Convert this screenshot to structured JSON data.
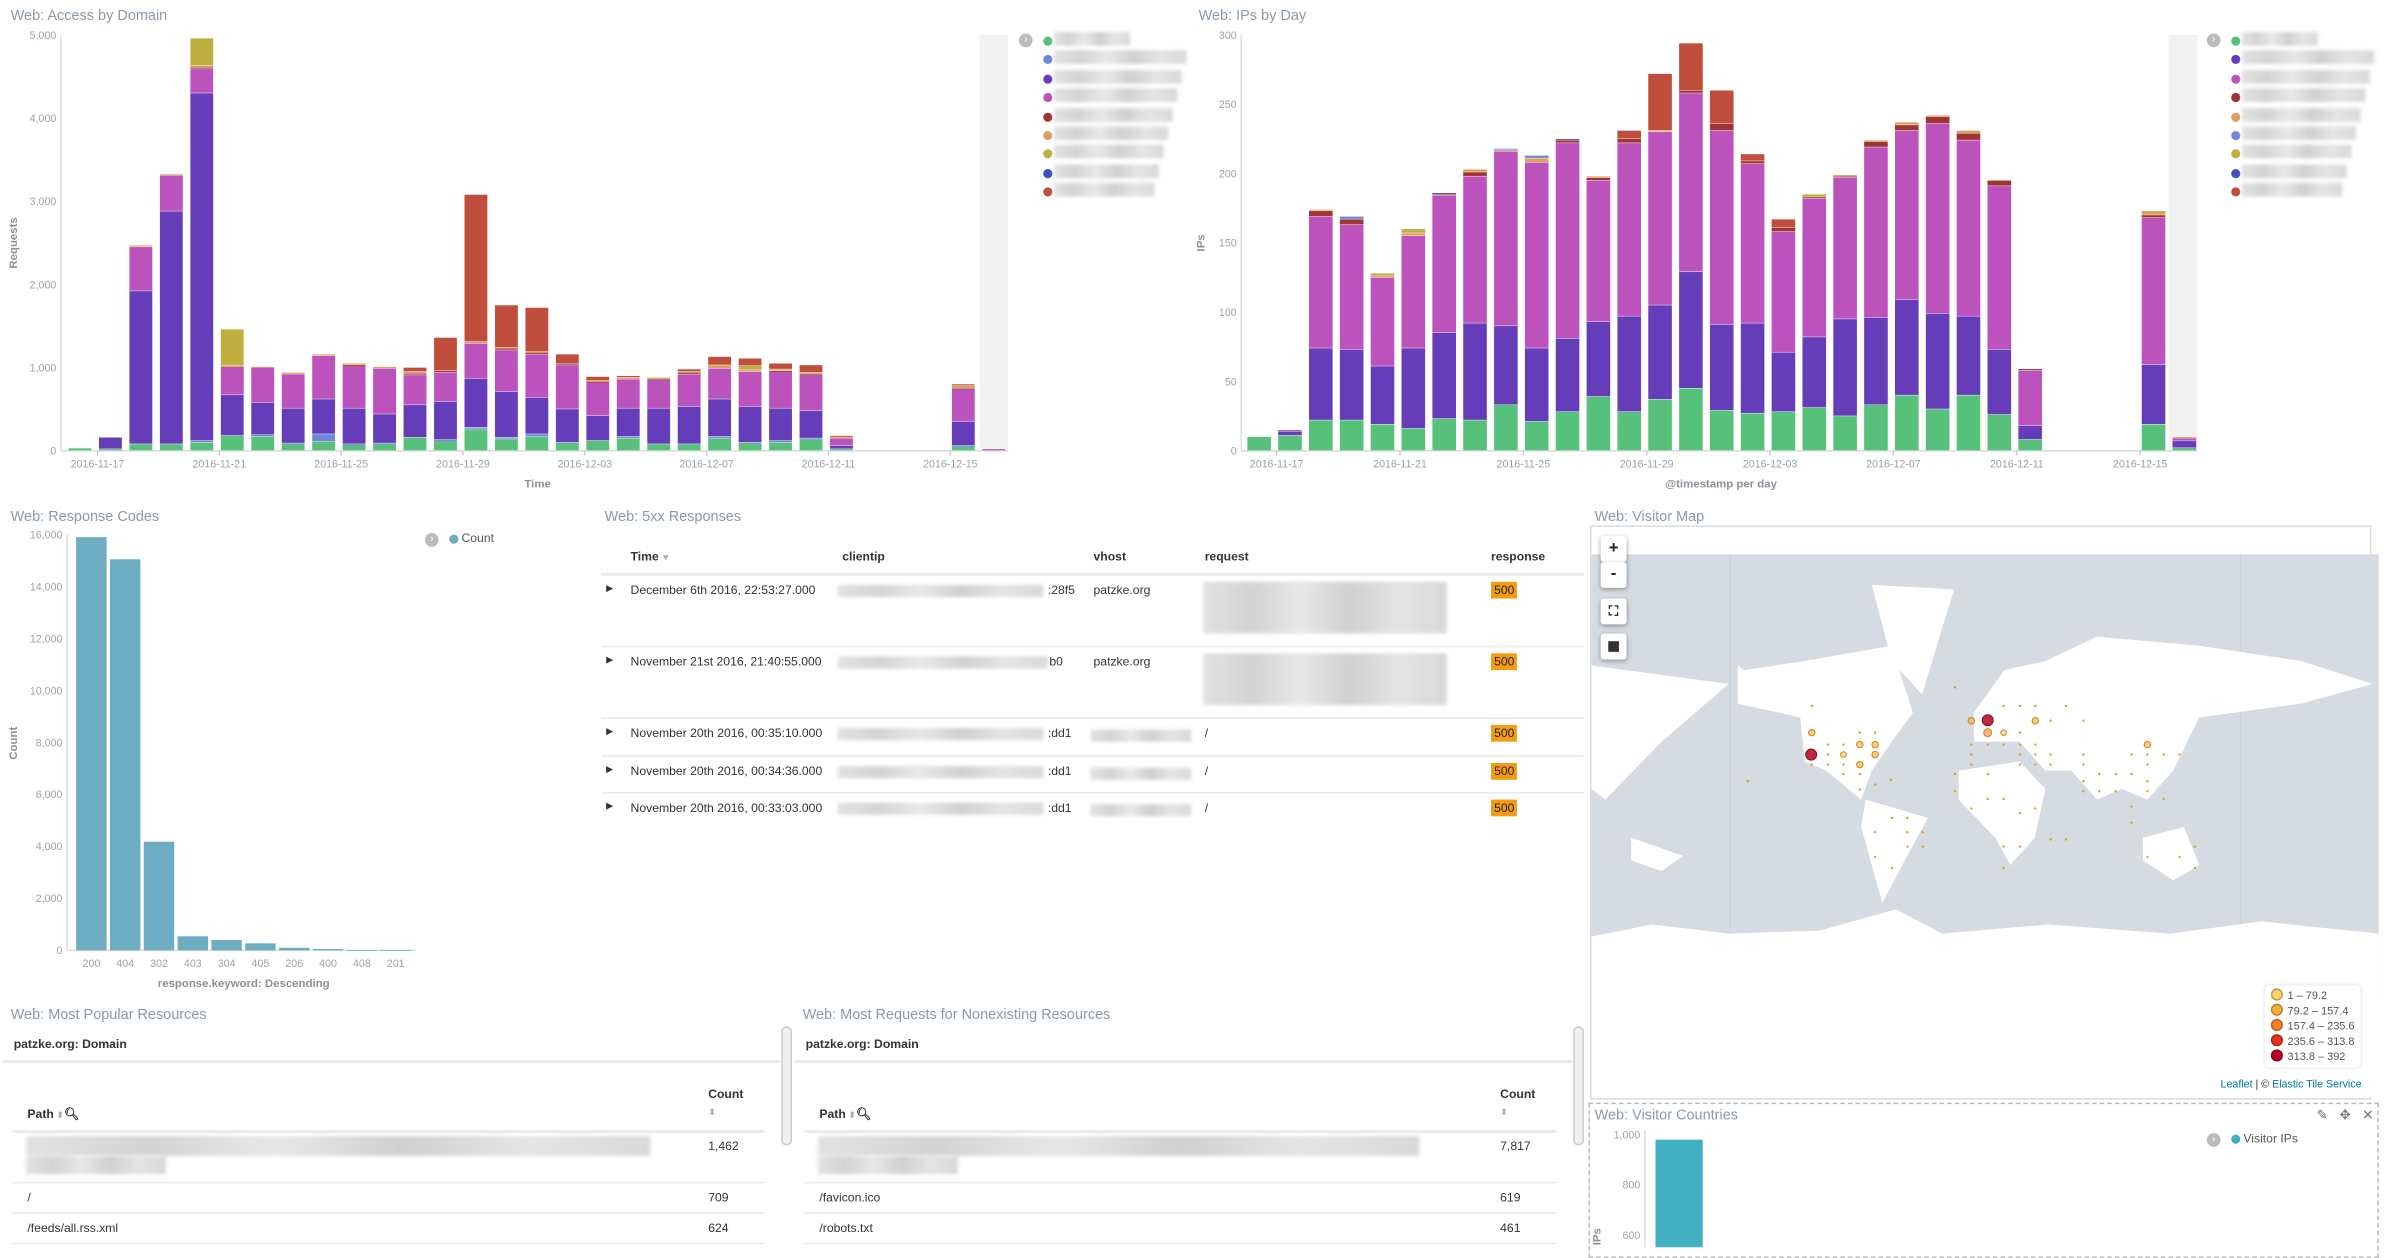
{
  "colors": {
    "green": "#57c17b",
    "lightblue": "#6f87d8",
    "purple": "#663db8",
    "magenta": "#bc52bc",
    "darkred": "#9e3533",
    "orange": "#daa05d",
    "olive": "#bfaf40",
    "blue": "#4050bf",
    "red": "#c04e3c",
    "teal": "#6eadc1",
    "cyan": "#41b0c3",
    "badge": "#f39c12"
  },
  "panels": {
    "access": {
      "title": "Web: Access by Domain"
    },
    "ips": {
      "title": "Web: IPs by Day"
    },
    "codes": {
      "title": "Web: Response Codes",
      "legend": "Count"
    },
    "errors": {
      "title": "Web: 5xx Responses"
    },
    "map": {
      "title": "Web: Visitor Map"
    },
    "popular": {
      "title": "Web: Most Popular Resources"
    },
    "missing": {
      "title": "Web: Most Requests for Nonexisting Resources"
    },
    "countries": {
      "title": "Web: Visitor Countries",
      "legend": "Visitor IPs"
    }
  },
  "chart_data": [
    {
      "type": "bar",
      "stacked": true,
      "title": "Web: Access by Domain",
      "xlabel": "Time",
      "ylabel": "Requests",
      "ylim": [
        0,
        5000
      ],
      "yticks": [
        "0",
        "1,000",
        "2,000",
        "3,000",
        "4,000",
        "5,000"
      ],
      "xticks": [
        "2016-11-17",
        "2016-11-21",
        "2016-11-25",
        "2016-11-29",
        "2016-12-03",
        "2016-12-07",
        "2016-12-11",
        "2016-12-15"
      ],
      "categories": [
        "2016-11-16",
        "2016-11-17",
        "2016-11-18",
        "2016-11-19",
        "2016-11-20",
        "2016-11-21",
        "2016-11-22",
        "2016-11-23",
        "2016-11-24",
        "2016-11-25",
        "2016-11-26",
        "2016-11-27",
        "2016-11-28",
        "2016-11-29",
        "2016-11-30",
        "2016-12-01",
        "2016-12-02",
        "2016-12-03",
        "2016-12-04",
        "2016-12-05",
        "2016-12-06",
        "2016-12-07",
        "2016-12-08",
        "2016-12-09",
        "2016-12-10",
        "2016-12-11",
        "2016-12-12",
        "2016-12-13",
        "2016-12-14",
        "2016-12-15",
        "2016-12-16"
      ],
      "legend_colors": [
        "#57c17b",
        "#6f87d8",
        "#663db8",
        "#bc52bc",
        "#9e3533",
        "#daa05d",
        "#bfaf40",
        "#4050bf",
        "#c04e3c"
      ],
      "legend_placement": "right",
      "series": [
        {
          "color": "#57c17b",
          "values": [
            30,
            20,
            80,
            80,
            100,
            180,
            170,
            80,
            110,
            70,
            80,
            160,
            120,
            260,
            140,
            170,
            90,
            120,
            150,
            80,
            80,
            150,
            90,
            100,
            140,
            20,
            0,
            0,
            0,
            50,
            0
          ]
        },
        {
          "color": "#6f87d8",
          "values": [
            0,
            0,
            0,
            0,
            20,
            0,
            20,
            10,
            90,
            10,
            10,
            0,
            10,
            20,
            20,
            30,
            10,
            0,
            20,
            0,
            0,
            20,
            10,
            20,
            10,
            0,
            0,
            0,
            0,
            10,
            0
          ]
        },
        {
          "color": "#663db8",
          "values": [
            0,
            140,
            1840,
            2800,
            4180,
            490,
            390,
            420,
            420,
            430,
            350,
            390,
            460,
            590,
            550,
            440,
            400,
            300,
            340,
            430,
            450,
            450,
            430,
            390,
            330,
            40,
            0,
            0,
            0,
            290,
            0
          ]
        },
        {
          "color": "#bc52bc",
          "values": [
            0,
            0,
            530,
            430,
            290,
            340,
            420,
            410,
            520,
            510,
            550,
            360,
            350,
            420,
            500,
            520,
            530,
            400,
            350,
            340,
            390,
            370,
            420,
            440,
            430,
            90,
            0,
            0,
            0,
            390,
            20
          ]
        },
        {
          "color": "#9e3533",
          "values": [
            0,
            0,
            0,
            0,
            20,
            0,
            0,
            0,
            0,
            10,
            0,
            20,
            20,
            0,
            20,
            20,
            20,
            10,
            0,
            10,
            20,
            0,
            0,
            10,
            10,
            0,
            0,
            0,
            0,
            10,
            0
          ]
        },
        {
          "color": "#daa05d",
          "values": [
            0,
            0,
            20,
            15,
            20,
            10,
            10,
            20,
            20,
            20,
            20,
            20,
            0,
            20,
            10,
            10,
            0,
            10,
            20,
            20,
            10,
            40,
            20,
            20,
            20,
            20,
            0,
            0,
            0,
            30,
            0
          ]
        },
        {
          "color": "#bfaf40",
          "values": [
            0,
            0,
            0,
            0,
            330,
            440,
            0,
            0,
            0,
            0,
            0,
            0,
            0,
            0,
            0,
            0,
            0,
            0,
            0,
            0,
            0,
            0,
            50,
            0,
            0,
            0,
            0,
            0,
            0,
            0,
            0
          ]
        },
        {
          "color": "#c04e3c",
          "values": [
            0,
            0,
            0,
            0,
            0,
            0,
            0,
            0,
            0,
            0,
            0,
            50,
            400,
            1770,
            510,
            530,
            110,
            50,
            20,
            0,
            30,
            100,
            90,
            70,
            90,
            10,
            0,
            0,
            0,
            20,
            0
          ]
        }
      ]
    },
    {
      "type": "bar",
      "stacked": true,
      "title": "Web: IPs by Day",
      "xlabel": "@timestamp per day",
      "ylabel": "IPs",
      "ylim": [
        0,
        300
      ],
      "yticks": [
        "0",
        "50",
        "100",
        "150",
        "200",
        "250",
        "300"
      ],
      "xticks": [
        "2016-11-17",
        "2016-11-21",
        "2016-11-25",
        "2016-11-29",
        "2016-12-03",
        "2016-12-07",
        "2016-12-11",
        "2016-12-15"
      ],
      "categories": [
        "2016-11-16",
        "2016-11-17",
        "2016-11-18",
        "2016-11-19",
        "2016-11-20",
        "2016-11-21",
        "2016-11-22",
        "2016-11-23",
        "2016-11-24",
        "2016-11-25",
        "2016-11-26",
        "2016-11-27",
        "2016-11-28",
        "2016-11-29",
        "2016-11-30",
        "2016-12-01",
        "2016-12-02",
        "2016-12-03",
        "2016-12-04",
        "2016-12-05",
        "2016-12-06",
        "2016-12-07",
        "2016-12-08",
        "2016-12-09",
        "2016-12-10",
        "2016-12-11",
        "2016-12-12",
        "2016-12-13",
        "2016-12-14",
        "2016-12-15",
        "2016-12-16"
      ],
      "legend_colors": [
        "#57c17b",
        "#663db8",
        "#bc52bc",
        "#9e3533",
        "#daa05d",
        "#6f87d8",
        "#bfaf40",
        "#4050bf",
        "#c04e3c"
      ],
      "legend_placement": "right",
      "series": [
        {
          "color": "#57c17b",
          "values": [
            10,
            11,
            22,
            22,
            19,
            16,
            23,
            22,
            33,
            21,
            28,
            39,
            28,
            37,
            45,
            29,
            27,
            28,
            31,
            25,
            33,
            40,
            30,
            40,
            26,
            8,
            0,
            0,
            0,
            19,
            2
          ]
        },
        {
          "color": "#663db8",
          "values": [
            0,
            3,
            52,
            51,
            42,
            58,
            62,
            70,
            57,
            53,
            53,
            54,
            69,
            68,
            84,
            62,
            65,
            43,
            51,
            70,
            63,
            69,
            69,
            57,
            47,
            10,
            0,
            0,
            0,
            43,
            5
          ]
        },
        {
          "color": "#bc52bc",
          "values": [
            0,
            1,
            95,
            90,
            64,
            81,
            99,
            106,
            126,
            134,
            141,
            102,
            125,
            125,
            129,
            140,
            115,
            87,
            100,
            102,
            123,
            122,
            137,
            127,
            118,
            40,
            0,
            0,
            0,
            106,
            2
          ]
        },
        {
          "color": "#9e3533",
          "values": [
            0,
            0,
            4,
            4,
            0,
            0,
            1,
            3,
            0,
            0,
            2,
            2,
            3,
            0,
            2,
            5,
            2,
            3,
            1,
            1,
            4,
            4,
            5,
            5,
            4,
            1,
            0,
            0,
            0,
            2,
            0
          ]
        },
        {
          "color": "#daa05d",
          "values": [
            0,
            0,
            1,
            0,
            1,
            2,
            0,
            2,
            1,
            3,
            0,
            1,
            0,
            1,
            0,
            0,
            0,
            0,
            0,
            1,
            1,
            2,
            1,
            2,
            0,
            0,
            0,
            0,
            0,
            3,
            1
          ]
        },
        {
          "color": "#6f87d8",
          "values": [
            0,
            0,
            0,
            2,
            0,
            0,
            0,
            0,
            1,
            2,
            0,
            0,
            0,
            0,
            0,
            0,
            0,
            0,
            0,
            0,
            0,
            0,
            0,
            0,
            0,
            0,
            0,
            0,
            0,
            0,
            0
          ]
        },
        {
          "color": "#bfaf40",
          "values": [
            0,
            0,
            0,
            0,
            2,
            3,
            0,
            0,
            0,
            0,
            0,
            0,
            0,
            0,
            0,
            0,
            0,
            0,
            2,
            0,
            0,
            0,
            0,
            0,
            0,
            0,
            0,
            0,
            0,
            0,
            0
          ]
        },
        {
          "color": "#4050bf",
          "values": [
            0,
            0,
            0,
            0,
            0,
            0,
            1,
            0,
            0,
            0,
            1,
            0,
            0,
            0,
            0,
            0,
            0,
            0,
            0,
            0,
            0,
            0,
            0,
            0,
            0,
            0,
            0,
            0,
            0,
            0,
            0
          ]
        },
        {
          "color": "#c04e3c",
          "values": [
            0,
            0,
            0,
            0,
            0,
            0,
            0,
            0,
            0,
            0,
            0,
            0,
            6,
            41,
            34,
            24,
            5,
            6,
            0,
            0,
            0,
            0,
            0,
            0,
            0,
            0,
            0,
            0,
            0,
            0,
            0
          ]
        }
      ]
    },
    {
      "type": "bar",
      "title": "Web: Response Codes",
      "xlabel": "response.keyword: Descending",
      "ylabel": "Count",
      "ylim": [
        0,
        16000
      ],
      "yticks": [
        "0",
        "2,000",
        "4,000",
        "6,000",
        "8,000",
        "10,000",
        "12,000",
        "14,000",
        "16,000"
      ],
      "categories": [
        "200",
        "404",
        "302",
        "403",
        "304",
        "405",
        "206",
        "400",
        "408",
        "201"
      ],
      "series": [
        {
          "name": "Count",
          "color": "#6eadc1",
          "values": [
            15900,
            15050,
            4180,
            540,
            400,
            270,
            100,
            50,
            15,
            5
          ]
        }
      ],
      "legend_placement": "top-right"
    },
    {
      "type": "bar",
      "title": "Web: Visitor Countries",
      "ylabel": "IPs",
      "yticks": [
        "600",
        "800",
        "1,000"
      ],
      "ylim_visible": [
        600,
        1000
      ],
      "series": [
        {
          "name": "Visitor IPs",
          "color": "#41b0c3",
          "values": [
            980
          ]
        }
      ],
      "legend_placement": "top-right"
    }
  ],
  "errors_table": {
    "columns": [
      "Time",
      "clientip",
      "vhost",
      "request",
      "response"
    ],
    "rows": [
      {
        "time": "December 6th 2016, 22:53:27.000",
        "clientip_suffix": ":28f5",
        "vhost": "patzke.org",
        "request": "",
        "response": "500"
      },
      {
        "time": "November 21st 2016, 21:40:55.000",
        "clientip_suffix": "b0",
        "vhost": "patzke.org",
        "request": "",
        "response": "500"
      },
      {
        "time": "November 20th 2016, 00:35:10.000",
        "clientip_suffix": ":dd1",
        "vhost": "",
        "request": "/",
        "response": "500"
      },
      {
        "time": "November 20th 2016, 00:34:36.000",
        "clientip_suffix": ":dd1",
        "vhost": "",
        "request": "/",
        "response": "500"
      },
      {
        "time": "November 20th 2016, 00:33:03.000",
        "clientip_suffix": ":dd1",
        "vhost": "",
        "request": "/",
        "response": "500"
      }
    ]
  },
  "popular": {
    "group": "patzke.org: Domain",
    "col_path": "Path",
    "col_count": "Count",
    "rows": [
      {
        "path": "",
        "count": "1,462"
      },
      {
        "path": "/",
        "count": "709"
      },
      {
        "path": "/feeds/all.rss.xml",
        "count": "624"
      }
    ]
  },
  "missing": {
    "group": "patzke.org: Domain",
    "col_path": "Path",
    "col_count": "Count",
    "rows": [
      {
        "path": "",
        "count": "7,817"
      },
      {
        "path": "/favicon.ico",
        "count": "619"
      },
      {
        "path": "/robots.txt",
        "count": "461"
      }
    ]
  },
  "map": {
    "zoom_in": "+",
    "zoom_out": "-",
    "legend": [
      {
        "label": "1 – 79.2",
        "color": "#fdd46b"
      },
      {
        "label": "79.2 – 157.4",
        "color": "#fbaa3d"
      },
      {
        "label": "157.4 – 235.6",
        "color": "#f6802e"
      },
      {
        "label": "235.6 – 313.8",
        "color": "#e8311f"
      },
      {
        "label": "313.8 – 392",
        "color": "#b7001f"
      }
    ],
    "attribution_leaflet": "Leaflet",
    "attribution_sep": " | © ",
    "attribution_tiles": "Elastic Tile Service"
  }
}
